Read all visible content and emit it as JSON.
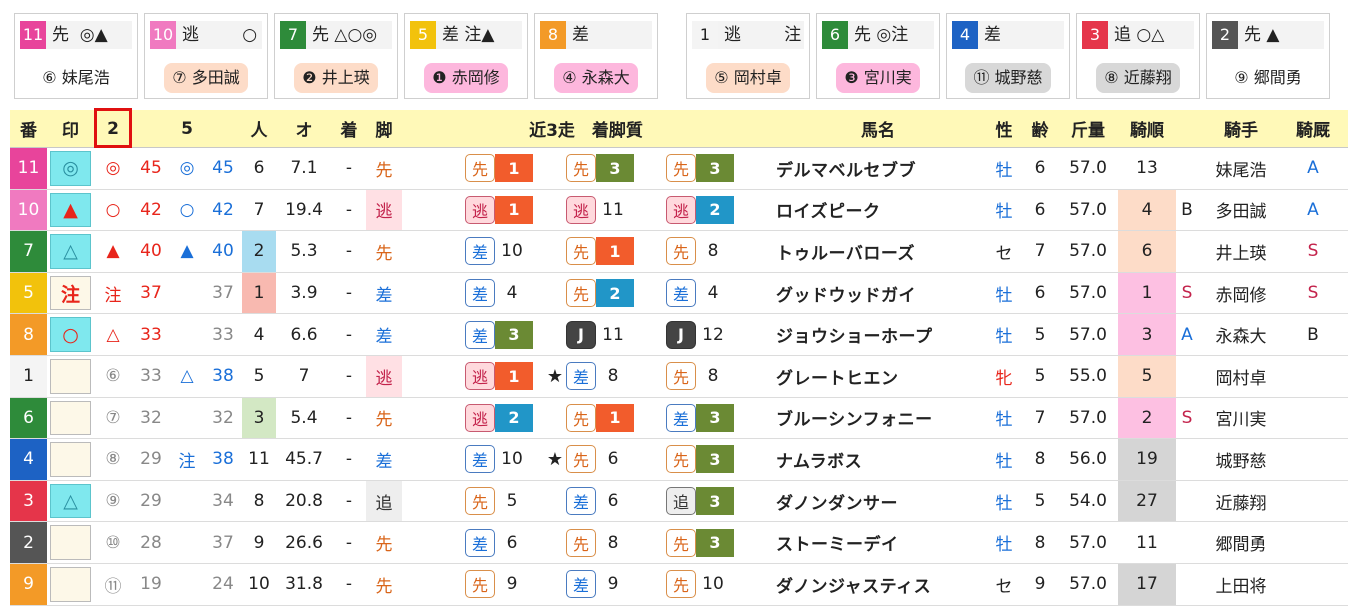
{
  "cards": [
    {
      "num": "11",
      "num_bg": "#e8449b",
      "mark": "先  ◎▲",
      "jockey": "⑥ 妹尾浩",
      "jockey_bg": "#ffffff"
    },
    {
      "num": "10",
      "num_bg": "#f07ac0",
      "mark": "逃        ○",
      "jockey": "⑦ 多田誠",
      "jockey_bg": "#fddcc8"
    },
    {
      "num": "7",
      "num_bg": "#2e8b3a",
      "mark": "先 △○◎",
      "jockey": "❷ 井上瑛",
      "jockey_bg": "#fddcc8"
    },
    {
      "num": "5",
      "num_bg": "#f2c20c",
      "mark": "差 注▲",
      "jockey": "❶ 赤岡修",
      "jockey_bg": "#fdb7dd"
    },
    {
      "num": "8",
      "num_bg": "#f39a27",
      "mark": "差",
      "jockey": "④ 永森大",
      "jockey_bg": "#fdb7dd"
    },
    {
      "num": "1",
      "num_bg": "#f4f4f4",
      "mark": "逃        注",
      "jockey": "⑤ 岡村卓",
      "jockey_bg": "#fddcc8"
    },
    {
      "num": "6",
      "num_bg": "#2e8b3a",
      "mark": "先 ◎注",
      "jockey": "❸ 宮川実",
      "jockey_bg": "#fdb7dd"
    },
    {
      "num": "4",
      "num_bg": "#1d62c4",
      "mark": "差",
      "jockey": "⑪ 城野慈",
      "jockey_bg": "#d8d8d8"
    },
    {
      "num": "3",
      "num_bg": "#e5354a",
      "mark": "追 ○△",
      "jockey": "⑧ 近藤翔",
      "jockey_bg": "#d8d8d8"
    },
    {
      "num": "2",
      "num_bg": "#555555",
      "mark": "先 ▲",
      "jockey": "⑨ 郷間勇",
      "jockey_bg": "#ffffff"
    }
  ],
  "header": {
    "ban": "番",
    "in": "印",
    "c2": "2",
    "c5": "5",
    "nin": "人",
    "odds": "オ",
    "chaku": "着",
    "kyaku": "脚",
    "recent": "近3走　着脚質",
    "name": "馬名",
    "sex": "性",
    "age": "齢",
    "kinryo": "斤量",
    "kijun": "騎順",
    "jockey": "騎手",
    "kikyu": "騎厩"
  },
  "rows": [
    {
      "num": "11",
      "num_bg": "#e8449b",
      "mark": "◎",
      "mark_teal": true,
      "m2": "◎",
      "m2c": "red",
      "v2": "45",
      "v2c": "red",
      "m5": "◎",
      "m5c": "blue",
      "v5": "45",
      "v5c": "blue",
      "pop": "6",
      "pop_bg": "",
      "odds": "7.1",
      "chaku": "-",
      "kyaku": "先",
      "kyaku_type": "sen",
      "races": [
        {
          "t": "先",
          "cls": "sen",
          "r": "1",
          "rb": "#f25c2c",
          "star": ""
        },
        {
          "t": "先",
          "cls": "sen",
          "r": "3",
          "rb": "#6b8a34",
          "star": ""
        },
        {
          "t": "先",
          "cls": "sen",
          "r": "3",
          "rb": "#6b8a34",
          "star": ""
        }
      ],
      "name": "デルマベルセブブ",
      "sex": "牡",
      "sex_c": "#1a6fd8",
      "age": "6",
      "kinryo": "57.0",
      "kijun": "13",
      "kijun_bg": "",
      "k2": "",
      "k2c": "",
      "jockey": "妹尾浩",
      "kikyu": "A",
      "kikyu_c": "#1a6fd8"
    },
    {
      "num": "10",
      "num_bg": "#f07ac0",
      "mark": "▲",
      "mark_teal": true,
      "m2": "○",
      "m2c": "red",
      "v2": "42",
      "v2c": "red",
      "m5": "○",
      "m5c": "blue",
      "v5": "42",
      "v5c": "blue",
      "pop": "7",
      "pop_bg": "",
      "odds": "19.4",
      "chaku": "-",
      "kyaku": "逃",
      "kyaku_type": "gen",
      "races": [
        {
          "t": "逃",
          "cls": "gen",
          "r": "1",
          "rb": "#f25c2c",
          "star": ""
        },
        {
          "t": "逃",
          "cls": "gen",
          "r": "11",
          "rb": "",
          "star": ""
        },
        {
          "t": "逃",
          "cls": "gen",
          "r": "2",
          "rb": "#2196c8",
          "star": ""
        }
      ],
      "name": "ロイズピーク",
      "sex": "牡",
      "sex_c": "#1a6fd8",
      "age": "6",
      "kinryo": "57.0",
      "kijun": "4",
      "kijun_bg": "#fddcc8",
      "k2": "B",
      "k2c": "#222",
      "jockey": "多田誠",
      "kikyu": "A",
      "kikyu_c": "#1a6fd8"
    },
    {
      "num": "7",
      "num_bg": "#2e8b3a",
      "mark": "△",
      "mark_teal": true,
      "m2": "▲",
      "m2c": "red",
      "v2": "40",
      "v2c": "red",
      "m5": "▲",
      "m5c": "blue",
      "v5": "40",
      "v5c": "blue",
      "pop": "2",
      "pop_bg": "#a8dcf0",
      "odds": "5.3",
      "chaku": "-",
      "kyaku": "先",
      "kyaku_type": "sen",
      "races": [
        {
          "t": "差",
          "cls": "sa",
          "r": "10",
          "rb": "",
          "star": ""
        },
        {
          "t": "先",
          "cls": "sen",
          "r": "1",
          "rb": "#f25c2c",
          "star": ""
        },
        {
          "t": "先",
          "cls": "sen",
          "r": "8",
          "rb": "",
          "star": ""
        }
      ],
      "name": "トゥルーバローズ",
      "sex": "セ",
      "sex_c": "#222",
      "age": "7",
      "kinryo": "57.0",
      "kijun": "6",
      "kijun_bg": "#fddcc8",
      "k2": "",
      "k2c": "",
      "jockey": "井上瑛",
      "kikyu": "S",
      "kikyu_c": "#c3224b"
    },
    {
      "num": "5",
      "num_bg": "#f2c20c",
      "mark": "注",
      "mark_teal": false,
      "m2": "注",
      "m2c": "red",
      "v2": "37",
      "v2c": "red",
      "m5": "",
      "m5c": "blue",
      "v5": "37",
      "v5c": "gray",
      "pop": "1",
      "pop_bg": "#f8b9b0",
      "odds": "3.9",
      "chaku": "-",
      "kyaku": "差",
      "kyaku_type": "sa",
      "races": [
        {
          "t": "差",
          "cls": "sa",
          "r": "4",
          "rb": "",
          "star": ""
        },
        {
          "t": "先",
          "cls": "sen",
          "r": "2",
          "rb": "#2196c8",
          "star": ""
        },
        {
          "t": "差",
          "cls": "sa",
          "r": "4",
          "rb": "",
          "star": ""
        }
      ],
      "name": "グッドウッドガイ",
      "sex": "牡",
      "sex_c": "#1a6fd8",
      "age": "6",
      "kinryo": "57.0",
      "kijun": "1",
      "kijun_bg": "#fdc0e2",
      "k2": "S",
      "k2c": "#c3224b",
      "jockey": "赤岡修",
      "kikyu": "S",
      "kikyu_c": "#c3224b"
    },
    {
      "num": "8",
      "num_bg": "#f39a27",
      "mark": "○",
      "mark_teal": true,
      "m2": "△",
      "m2c": "red",
      "v2": "33",
      "v2c": "red",
      "m5": "",
      "m5c": "blue",
      "v5": "33",
      "v5c": "gray",
      "pop": "4",
      "pop_bg": "",
      "odds": "6.6",
      "chaku": "-",
      "kyaku": "差",
      "kyaku_type": "sa",
      "races": [
        {
          "t": "差",
          "cls": "sa",
          "r": "3",
          "rb": "#6b8a34",
          "star": ""
        },
        {
          "t": "J",
          "cls": "J",
          "r": "11",
          "rb": "",
          "star": ""
        },
        {
          "t": "J",
          "cls": "J",
          "r": "12",
          "rb": "",
          "star": ""
        }
      ],
      "name": "ジョウショーホープ",
      "sex": "牡",
      "sex_c": "#1a6fd8",
      "age": "5",
      "kinryo": "57.0",
      "kijun": "3",
      "kijun_bg": "#fdc0e2",
      "k2": "A",
      "k2c": "#1a6fd8",
      "jockey": "永森大",
      "kikyu": "B",
      "kikyu_c": "#222"
    },
    {
      "num": "1",
      "num_bg": "#f4f4f4",
      "mark": "",
      "mark_teal": false,
      "m2": "⑥",
      "m2c": "gray",
      "v2": "33",
      "v2c": "gray",
      "m5": "△",
      "m5c": "blue",
      "v5": "38",
      "v5c": "blue",
      "pop": "5",
      "pop_bg": "",
      "odds": "7",
      "chaku": "-",
      "kyaku": "逃",
      "kyaku_type": "gen",
      "races": [
        {
          "t": "逃",
          "cls": "gen",
          "r": "1",
          "rb": "#f25c2c",
          "star": ""
        },
        {
          "t": "差",
          "cls": "sa",
          "r": "8",
          "rb": "",
          "star": "★"
        },
        {
          "t": "先",
          "cls": "sen",
          "r": "8",
          "rb": "",
          "star": ""
        }
      ],
      "name": "グレートヒエン",
      "sex": "牝",
      "sex_c": "#e8251b",
      "age": "5",
      "kinryo": "55.0",
      "kijun": "5",
      "kijun_bg": "#fddcc8",
      "k2": "",
      "k2c": "",
      "jockey": "岡村卓",
      "kikyu": "",
      "kikyu_c": "#222"
    },
    {
      "num": "6",
      "num_bg": "#2e8b3a",
      "mark": "",
      "mark_teal": false,
      "m2": "⑦",
      "m2c": "gray",
      "v2": "32",
      "v2c": "gray",
      "m5": "",
      "m5c": "blue",
      "v5": "32",
      "v5c": "gray",
      "pop": "3",
      "pop_bg": "#d3e8c4",
      "odds": "5.4",
      "chaku": "-",
      "kyaku": "先",
      "kyaku_type": "sen",
      "races": [
        {
          "t": "逃",
          "cls": "gen",
          "r": "2",
          "rb": "#2196c8",
          "star": ""
        },
        {
          "t": "先",
          "cls": "sen",
          "r": "1",
          "rb": "#f25c2c",
          "star": ""
        },
        {
          "t": "差",
          "cls": "sa",
          "r": "3",
          "rb": "#6b8a34",
          "star": ""
        }
      ],
      "name": "ブルーシンフォニー",
      "sex": "牡",
      "sex_c": "#1a6fd8",
      "age": "7",
      "kinryo": "57.0",
      "kijun": "2",
      "kijun_bg": "#fdc0e2",
      "k2": "S",
      "k2c": "#c3224b",
      "jockey": "宮川実",
      "kikyu": "",
      "kikyu_c": "#222"
    },
    {
      "num": "4",
      "num_bg": "#1d62c4",
      "mark": "",
      "mark_teal": false,
      "m2": "⑧",
      "m2c": "gray",
      "v2": "29",
      "v2c": "gray",
      "m5": "注",
      "m5c": "blue",
      "v5": "38",
      "v5c": "blue",
      "pop": "11",
      "pop_bg": "",
      "odds": "45.7",
      "chaku": "-",
      "kyaku": "差",
      "kyaku_type": "sa",
      "races": [
        {
          "t": "差",
          "cls": "sa",
          "r": "10",
          "rb": "",
          "star": ""
        },
        {
          "t": "先",
          "cls": "sen",
          "r": "6",
          "rb": "",
          "star": "★"
        },
        {
          "t": "先",
          "cls": "sen",
          "r": "3",
          "rb": "#6b8a34",
          "star": ""
        }
      ],
      "name": "ナムラボス",
      "sex": "牡",
      "sex_c": "#1a6fd8",
      "age": "8",
      "kinryo": "56.0",
      "kijun": "19",
      "kijun_bg": "#d5d5d5",
      "k2": "",
      "k2c": "",
      "jockey": "城野慈",
      "kikyu": "",
      "kikyu_c": "#222"
    },
    {
      "num": "3",
      "num_bg": "#e5354a",
      "mark": "△",
      "mark_teal": true,
      "m2": "⑨",
      "m2c": "gray",
      "v2": "29",
      "v2c": "gray",
      "m5": "",
      "m5c": "blue",
      "v5": "34",
      "v5c": "gray",
      "pop": "8",
      "pop_bg": "",
      "odds": "20.8",
      "chaku": "-",
      "kyaku": "追",
      "kyaku_type": "oi",
      "races": [
        {
          "t": "先",
          "cls": "sen",
          "r": "5",
          "rb": "",
          "star": ""
        },
        {
          "t": "差",
          "cls": "sa",
          "r": "6",
          "rb": "",
          "star": ""
        },
        {
          "t": "追",
          "cls": "oi",
          "r": "3",
          "rb": "#6b8a34",
          "star": ""
        }
      ],
      "name": "ダノンダンサー",
      "sex": "牡",
      "sex_c": "#1a6fd8",
      "age": "5",
      "kinryo": "54.0",
      "kijun": "27",
      "kijun_bg": "#d5d5d5",
      "k2": "",
      "k2c": "",
      "jockey": "近藤翔",
      "kikyu": "",
      "kikyu_c": "#222"
    },
    {
      "num": "2",
      "num_bg": "#555555",
      "mark": "",
      "mark_teal": false,
      "m2": "⑩",
      "m2c": "gray",
      "v2": "28",
      "v2c": "gray",
      "m5": "",
      "m5c": "blue",
      "v5": "37",
      "v5c": "gray",
      "pop": "9",
      "pop_bg": "",
      "odds": "26.6",
      "chaku": "-",
      "kyaku": "先",
      "kyaku_type": "sen",
      "races": [
        {
          "t": "差",
          "cls": "sa",
          "r": "6",
          "rb": "",
          "star": ""
        },
        {
          "t": "先",
          "cls": "sen",
          "r": "8",
          "rb": "",
          "star": ""
        },
        {
          "t": "先",
          "cls": "sen",
          "r": "3",
          "rb": "#6b8a34",
          "star": ""
        }
      ],
      "name": "ストーミーデイ",
      "sex": "牡",
      "sex_c": "#1a6fd8",
      "age": "8",
      "kinryo": "57.0",
      "kijun": "11",
      "kijun_bg": "",
      "k2": "",
      "k2c": "",
      "jockey": "郷間勇",
      "kikyu": "",
      "kikyu_c": "#222"
    },
    {
      "num": "9",
      "num_bg": "#f39a27",
      "mark": "",
      "mark_teal": false,
      "m2": "⑪",
      "m2c": "gray",
      "v2": "19",
      "v2c": "gray",
      "m5": "",
      "m5c": "blue",
      "v5": "24",
      "v5c": "gray",
      "pop": "10",
      "pop_bg": "",
      "odds": "31.8",
      "chaku": "-",
      "kyaku": "先",
      "kyaku_type": "sen",
      "races": [
        {
          "t": "先",
          "cls": "sen",
          "r": "9",
          "rb": "",
          "star": ""
        },
        {
          "t": "差",
          "cls": "sa",
          "r": "9",
          "rb": "",
          "star": ""
        },
        {
          "t": "先",
          "cls": "sen",
          "r": "10",
          "rb": "",
          "star": ""
        }
      ],
      "name": "ダノンジャスティス",
      "sex": "セ",
      "sex_c": "#222",
      "age": "9",
      "kinryo": "57.0",
      "kijun": "17",
      "kijun_bg": "#d5d5d5",
      "k2": "",
      "k2c": "",
      "jockey": "上田将",
      "kikyu": "",
      "kikyu_c": "#222"
    }
  ]
}
